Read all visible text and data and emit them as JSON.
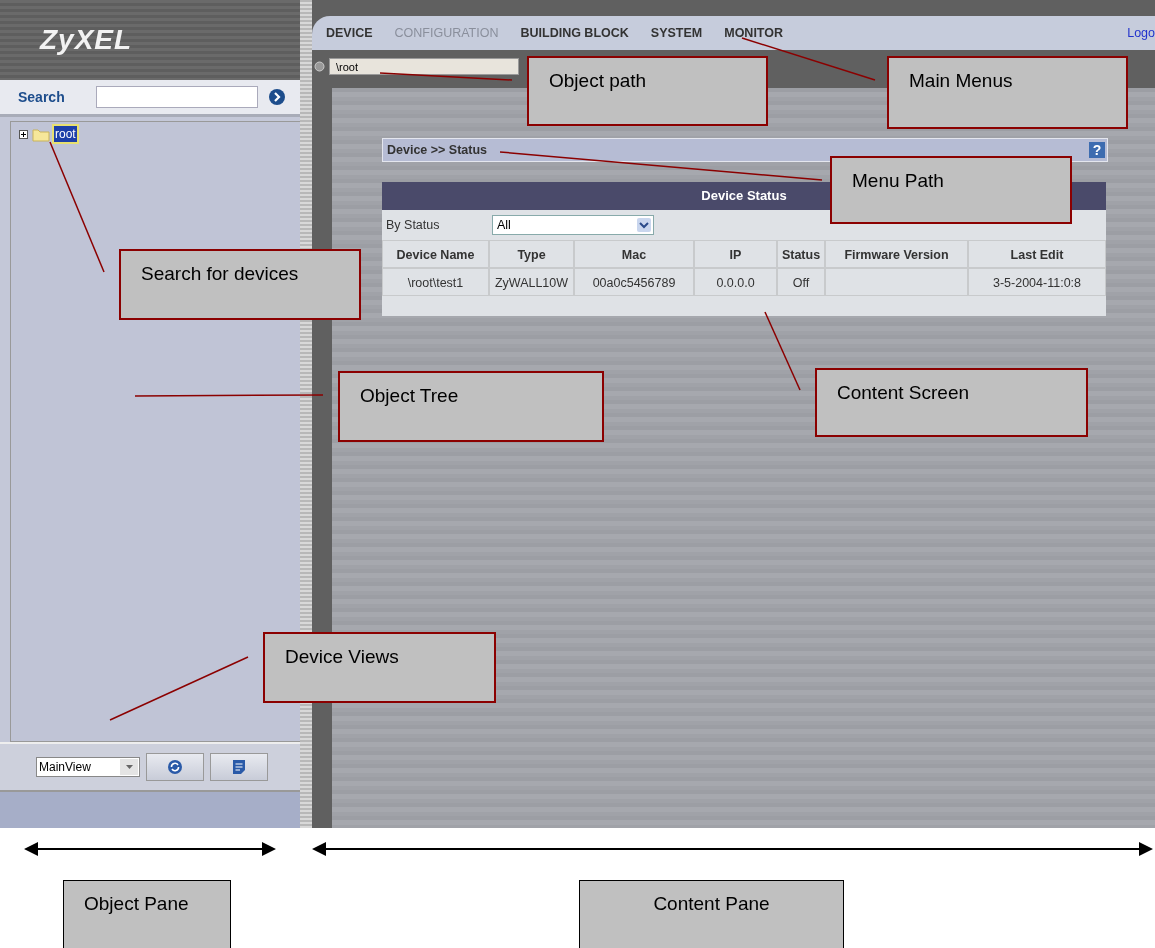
{
  "logo": "ZyXEL",
  "search": {
    "label": "Search"
  },
  "tree": [
    {
      "label": "root",
      "expanded": false,
      "selected": true
    }
  ],
  "view_select": {
    "value": "MainView"
  },
  "menus": [
    {
      "label": "DEVICE",
      "disabled": false
    },
    {
      "label": "CONFIGURATION",
      "disabled": true
    },
    {
      "label": "BUILDING BLOCK",
      "disabled": false
    },
    {
      "label": "SYSTEM",
      "disabled": false
    },
    {
      "label": "MONITOR",
      "disabled": false
    }
  ],
  "logout_link": "Logo",
  "object_path": "\\root",
  "menu_path": "Device >> Status",
  "help": "?",
  "panel": {
    "title": "Device Status",
    "filter_label": "By Status",
    "filter_value": "All",
    "columns": [
      "Device Name",
      "Type",
      "Mac",
      "IP",
      "Status",
      "Firmware Version",
      "Last Edit"
    ],
    "rows": [
      {
        "cells": [
          "\\root\\test1",
          "ZyWALL10W",
          "00a0c5456789",
          "0.0.0.0",
          "Off",
          null,
          "3-5-2004-11:0:8"
        ]
      }
    ]
  },
  "callouts": [
    "Object path",
    "Main Menus",
    "Menu Path",
    "Search for devices",
    "Object Tree",
    "Content Screen",
    "Device Views"
  ],
  "pane_labels": [
    "Object Pane",
    "Content Pane"
  ]
}
